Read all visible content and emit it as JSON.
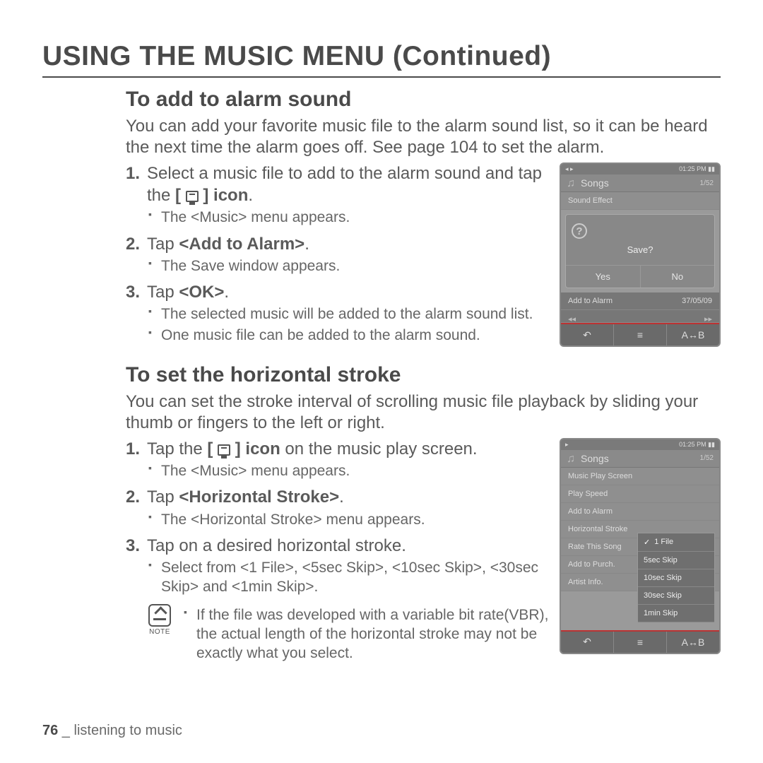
{
  "title": "USING THE MUSIC MENU (Continued)",
  "section1": {
    "heading": "To add to alarm sound",
    "intro": "You can add your favorite music file to the alarm sound list, so it can be heard the next time the alarm goes off. See page 104 to set the alarm.",
    "steps": [
      {
        "pre": "Select a music file to add to the alarm sound and tap the ",
        "bold": "[",
        "post_bold": " icon",
        "post": ".",
        "bullets": [
          "The <Music> menu appears."
        ]
      },
      {
        "pre": "Tap ",
        "bold": "<Add to Alarm>",
        "post": ".",
        "bullets": [
          "The Save window appears."
        ]
      },
      {
        "pre": "Tap ",
        "bold": "<OK>",
        "post": ".",
        "bullets": [
          "The selected music will be added to the alarm sound list.",
          "One music file can be added to the alarm sound."
        ]
      }
    ],
    "device": {
      "status_left": "◂ ▸",
      "status_time": "01:25 PM",
      "header_title": "Songs",
      "header_count": "1/52",
      "menu_label": "Sound Effect",
      "dialog_prompt": "Save?",
      "yes": "Yes",
      "no": "No",
      "bottom_row": "Add to Alarm",
      "bottom_right": "37/05/09"
    }
  },
  "section2": {
    "heading": "To set the horizontal stroke",
    "intro": "You can set the stroke interval of scrolling music file playback by sliding your thumb or fingers to the left or right.",
    "steps": [
      {
        "pre": "Tap the ",
        "bold": "[",
        "post_bold": " icon",
        "post": " on the music play screen.",
        "bullets": [
          "The <Music> menu appears."
        ]
      },
      {
        "pre": "Tap ",
        "bold": "<Horizontal Stroke>",
        "post": ".",
        "bullets": [
          "The <Horizontal Stroke> menu appears."
        ]
      },
      {
        "pre": "Tap on a desired horizontal stroke.",
        "bold": "",
        "post": "",
        "bullets": [
          "Select from <1 File>, <5sec Skip>, <10sec Skip>, <30sec Skip> and <1min Skip>."
        ]
      }
    ],
    "note_label": "NOTE",
    "note_text": "If the file was developed with a variable bit rate(VBR), the actual length of the horizontal stroke may not be exactly what you select.",
    "device": {
      "status_left": "▸",
      "status_time": "01:25 PM",
      "header_title": "Songs",
      "header_count": "1/52",
      "menu": [
        "Music Play Screen",
        "Play Speed",
        "Add to Alarm",
        "Horizontal Stroke",
        "Rate This Song",
        "Add to Purch.",
        "Artist Info."
      ],
      "submenu": [
        "1 File",
        "5sec Skip",
        "10sec Skip",
        "30sec Skip",
        "1min Skip"
      ]
    }
  },
  "footer": {
    "page": "76",
    "sep": " _ ",
    "chapter": "listening to music"
  },
  "icons": {
    "back": "↶",
    "menu": "≡",
    "ab": "A↔B"
  }
}
